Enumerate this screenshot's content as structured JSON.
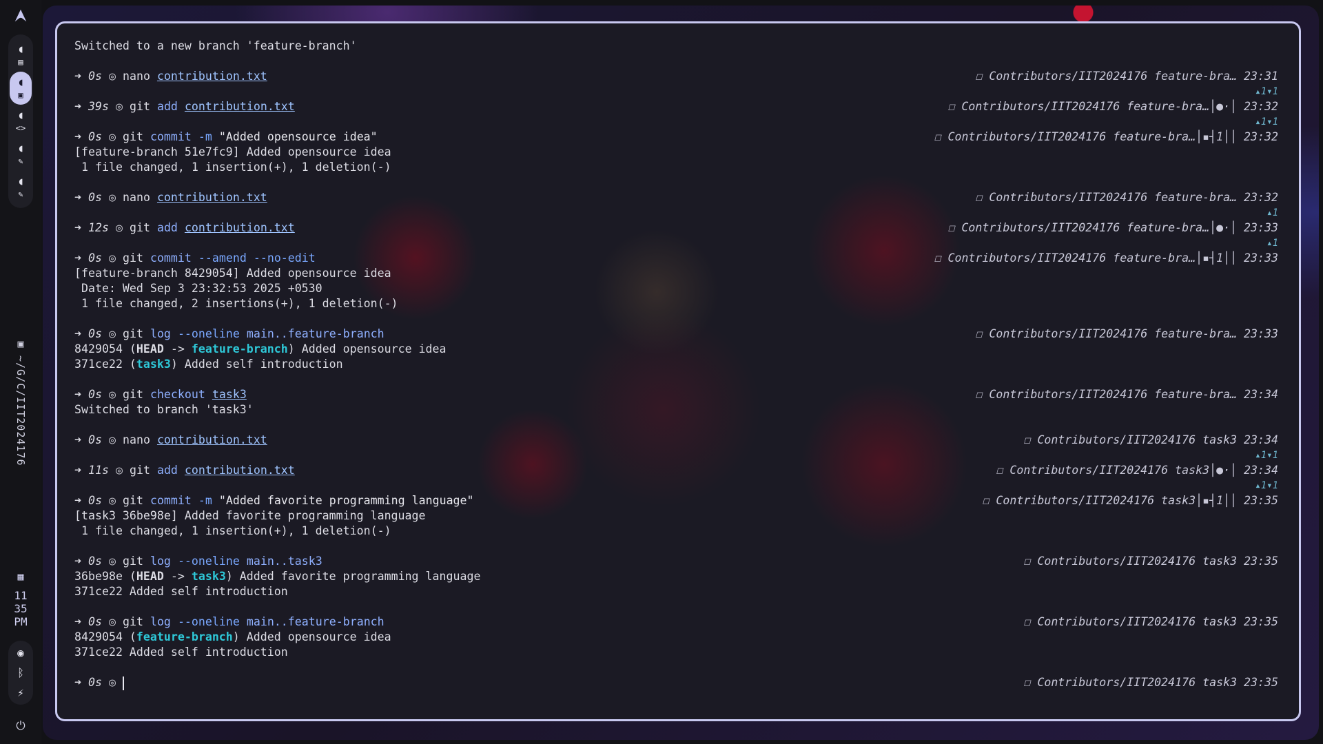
{
  "sidebar": {
    "logo_icon": "arch-logo-icon",
    "workspaces": [
      {
        "glyph": "◖",
        "sub": "▤",
        "active": false
      },
      {
        "glyph": "◖",
        "sub": "▣",
        "active": true
      },
      {
        "glyph": "◖",
        "sub": "<>",
        "active": false
      },
      {
        "glyph": "◖",
        "sub": "✎",
        "active": false
      },
      {
        "glyph": "◖",
        "sub": "✎",
        "active": false
      }
    ],
    "path_icon": "▣",
    "path": "~/G/C/IIT2024176",
    "calendar_icon": "▦",
    "clock_hour": "11",
    "clock_min": "35",
    "clock_ampm": "PM",
    "wifi_icon": "◉",
    "bt_icon": "ᛒ",
    "battery_icon": "⚡",
    "power_icon": "⏻"
  },
  "terminal": {
    "lines": [
      {
        "type": "out",
        "text": "Switched to a new branch 'feature-branch'"
      },
      {
        "type": "blank"
      },
      {
        "type": "cmd",
        "dur": "0s",
        "cmd": "nano",
        "args": [
          {
            "t": "contribution.txt",
            "c": "file"
          }
        ],
        "right": "☐ Contributors/IIT2024176 feature-bra… 23:31"
      },
      {
        "type": "ahead",
        "text": "▴1▾1"
      },
      {
        "type": "cmd",
        "dur": "39s",
        "cmd": "git",
        "args": [
          {
            "t": "add",
            "c": "sub"
          },
          {
            "t": "contribution.txt",
            "c": "file"
          }
        ],
        "right": "☐ Contributors/IIT2024176 feature-bra…│●·│ 23:32"
      },
      {
        "type": "ahead",
        "text": "▴1▾1"
      },
      {
        "type": "cmd",
        "dur": "0s",
        "cmd": "git",
        "args": [
          {
            "t": "commit",
            "c": "sub"
          },
          {
            "t": "-m",
            "c": "flag"
          },
          {
            "t": "\"Added opensource idea\"",
            "c": "str"
          }
        ],
        "right": "☐ Contributors/IIT2024176 feature-bra…│▪┤1││ 23:32"
      },
      {
        "type": "out",
        "text": "[feature-branch 51e7fc9] Added opensource idea"
      },
      {
        "type": "out",
        "text": " 1 file changed, 1 insertion(+), 1 deletion(-)"
      },
      {
        "type": "blank"
      },
      {
        "type": "cmd",
        "dur": "0s",
        "cmd": "nano",
        "args": [
          {
            "t": "contribution.txt",
            "c": "file"
          }
        ],
        "right": "☐ Contributors/IIT2024176 feature-bra… 23:32"
      },
      {
        "type": "ahead",
        "text": "▴1"
      },
      {
        "type": "cmd",
        "dur": "12s",
        "cmd": "git",
        "args": [
          {
            "t": "add",
            "c": "sub"
          },
          {
            "t": "contribution.txt",
            "c": "file"
          }
        ],
        "right": "☐ Contributors/IIT2024176 feature-bra…│●·│ 23:33"
      },
      {
        "type": "ahead",
        "text": "▴1"
      },
      {
        "type": "cmd",
        "dur": "0s",
        "cmd": "git",
        "args": [
          {
            "t": "commit",
            "c": "sub"
          },
          {
            "t": "--amend",
            "c": "flag"
          },
          {
            "t": "--no-edit",
            "c": "flag"
          }
        ],
        "right": "☐ Contributors/IIT2024176 feature-bra…│▪┤1││ 23:33"
      },
      {
        "type": "out",
        "text": "[feature-branch 8429054] Added opensource idea"
      },
      {
        "type": "out",
        "text": " Date: Wed Sep 3 23:32:53 2025 +0530"
      },
      {
        "type": "out",
        "text": " 1 file changed, 2 insertions(+), 1 deletion(-)"
      },
      {
        "type": "blank"
      },
      {
        "type": "cmd",
        "dur": "0s",
        "cmd": "git",
        "args": [
          {
            "t": "log",
            "c": "sub"
          },
          {
            "t": "--oneline",
            "c": "flag"
          },
          {
            "t": "main..feature-branch",
            "c": "sub"
          }
        ],
        "right": "☐ Contributors/IIT2024176 feature-bra… 23:33"
      },
      {
        "type": "log",
        "hash": "8429054",
        "head": true,
        "branch": "feature-branch",
        "msg": "Added opensource idea"
      },
      {
        "type": "log",
        "hash": "371ce22",
        "head": false,
        "branch": "task3",
        "msg": "Added self introduction"
      },
      {
        "type": "blank"
      },
      {
        "type": "cmd",
        "dur": "0s",
        "cmd": "git",
        "args": [
          {
            "t": "checkout",
            "c": "sub"
          },
          {
            "t": "task3",
            "c": "file"
          }
        ],
        "right": "☐ Contributors/IIT2024176 feature-bra… 23:34"
      },
      {
        "type": "out",
        "text": "Switched to branch 'task3'"
      },
      {
        "type": "blank"
      },
      {
        "type": "cmd",
        "dur": "0s",
        "cmd": "nano",
        "args": [
          {
            "t": "contribution.txt",
            "c": "file"
          }
        ],
        "right": "☐ Contributors/IIT2024176 task3 23:34"
      },
      {
        "type": "ahead",
        "text": "▴1▾1"
      },
      {
        "type": "cmd",
        "dur": "11s",
        "cmd": "git",
        "args": [
          {
            "t": "add",
            "c": "sub"
          },
          {
            "t": "contribution.txt",
            "c": "file"
          }
        ],
        "right": "☐ Contributors/IIT2024176 task3│●·│ 23:34"
      },
      {
        "type": "ahead",
        "text": "▴1▾1"
      },
      {
        "type": "cmd",
        "dur": "0s",
        "cmd": "git",
        "args": [
          {
            "t": "commit",
            "c": "sub"
          },
          {
            "t": "-m",
            "c": "flag"
          },
          {
            "t": "\"Added favorite programming language\"",
            "c": "str"
          }
        ],
        "right": "☐ Contributors/IIT2024176 task3│▪┤1││ 23:35"
      },
      {
        "type": "out",
        "text": "[task3 36be98e] Added favorite programming language"
      },
      {
        "type": "out",
        "text": " 1 file changed, 1 insertion(+), 1 deletion(-)"
      },
      {
        "type": "blank"
      },
      {
        "type": "cmd",
        "dur": "0s",
        "cmd": "git",
        "args": [
          {
            "t": "log",
            "c": "sub"
          },
          {
            "t": "--oneline",
            "c": "flag"
          },
          {
            "t": "main..task3",
            "c": "sub"
          }
        ],
        "right": "☐ Contributors/IIT2024176 task3 23:35"
      },
      {
        "type": "log",
        "hash": "36be98e",
        "head": true,
        "branch": "task3",
        "msg": "Added favorite programming language"
      },
      {
        "type": "out",
        "text": "371ce22 Added self introduction"
      },
      {
        "type": "blank"
      },
      {
        "type": "cmd",
        "dur": "0s",
        "cmd": "git",
        "args": [
          {
            "t": "log",
            "c": "sub"
          },
          {
            "t": "--oneline",
            "c": "flag"
          },
          {
            "t": "main..feature-branch",
            "c": "sub"
          }
        ],
        "right": "☐ Contributors/IIT2024176 task3 23:35"
      },
      {
        "type": "log",
        "hash": "8429054",
        "head": false,
        "branch": "feature-branch",
        "msg": "Added opensource idea"
      },
      {
        "type": "out",
        "text": "371ce22 Added self introduction"
      },
      {
        "type": "blank"
      },
      {
        "type": "prompt",
        "dur": "0s",
        "right": "☐ Contributors/IIT2024176 task3 23:35"
      }
    ]
  },
  "colors": {
    "accent": "#c8c8f0",
    "branch": "#2ec8d8",
    "subcommand": "#8fb0ff",
    "file": "#9fc4ff"
  }
}
